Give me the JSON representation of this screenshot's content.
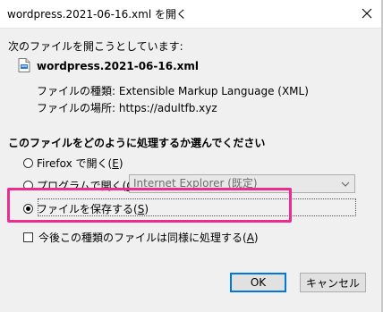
{
  "window": {
    "title": "wordpress.2021-06-16.xml を開く",
    "close_icon": "close-icon"
  },
  "dialog": {
    "lead_text": "次のファイルを開こうとしています:",
    "file": {
      "icon": "xml-file-icon",
      "name": "wordpress.2021-06-16.xml"
    },
    "info": [
      {
        "label": "ファイルの種類:",
        "value": "Extensible Markup Language (XML)"
      },
      {
        "label": "ファイルの場所:",
        "value": "https://adultfb.xyz"
      }
    ],
    "question": "このファイルをどのように処理するか選んでください",
    "options": {
      "open_with_firefox": {
        "label": "Firefox で開く(",
        "key": "E",
        "suffix": ")",
        "checked": false
      },
      "open_with_program": {
        "label": "プログラムで開く(",
        "key": "O",
        "suffix": "):",
        "checked": false
      },
      "save_file": {
        "label": "ファイルを保存する(",
        "key": "S",
        "suffix": ")",
        "checked": true
      }
    },
    "program_select": {
      "selected": "Internet Explorer (既定)",
      "enabled": false
    },
    "remember": {
      "label": "今後この種類のファイルは同様に処理する(",
      "key": "A",
      "suffix": ")",
      "checked": false
    },
    "buttons": {
      "ok": "OK",
      "cancel": "キャンセル"
    },
    "colors": {
      "highlight": "#ea2d8f",
      "focus_button": "#0078d7",
      "background": "#f0f0f0"
    }
  }
}
